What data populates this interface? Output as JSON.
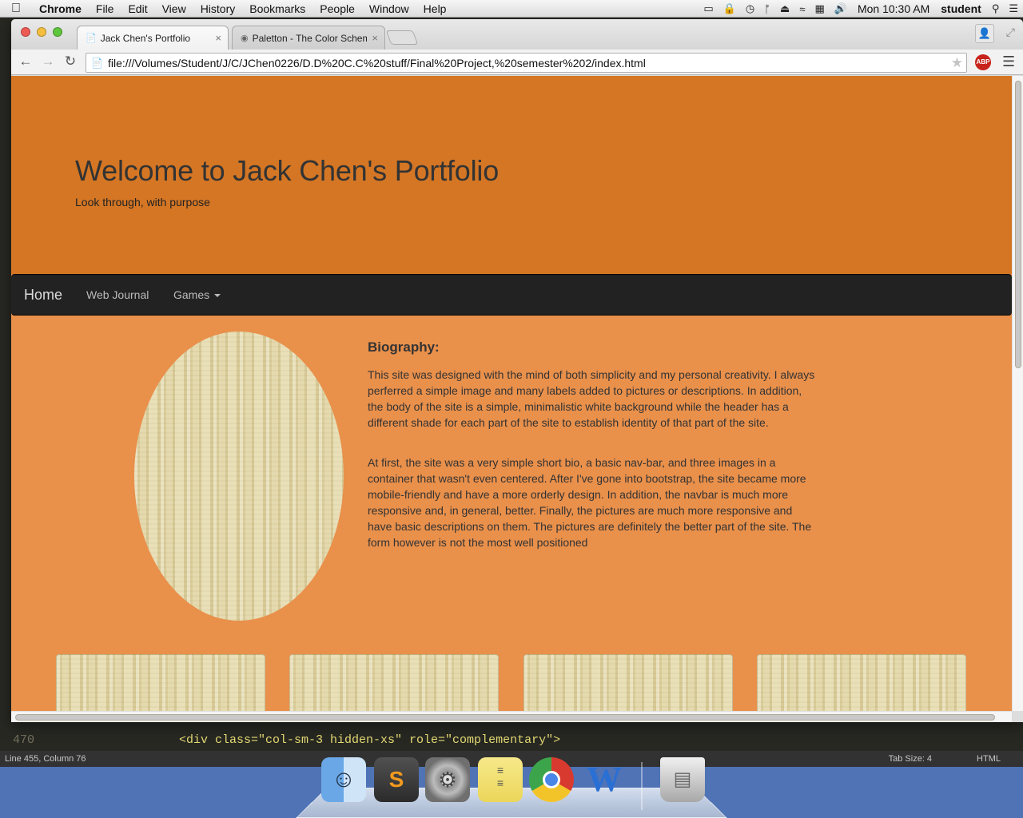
{
  "menubar": {
    "apple": "",
    "items": [
      "Chrome",
      "File",
      "Edit",
      "View",
      "History",
      "Bookmarks",
      "People",
      "Window",
      "Help"
    ],
    "clock": "Mon 10:30 AM",
    "user": "student"
  },
  "editor": {
    "line_number": "470",
    "code_line": "<div class=\"col-sm-3 hidden-xs\" role=\"complementary\">",
    "status_left": "Line 455, Column 76",
    "tab_size": "Tab Size: 4",
    "syntax": "HTML"
  },
  "browser": {
    "tabs": [
      {
        "title": "Jack Chen's Portfolio",
        "active": true
      },
      {
        "title": "Paletton - The Color Schem",
        "active": false
      }
    ],
    "url": "file:///Volumes/Student/J/C/JChen0226/D.D%20C.C%20stuff/Final%20Project,%20semester%202/index.html",
    "abp_label": "ABP"
  },
  "page": {
    "colors": {
      "jumbotron": "#d47624",
      "body": "#e9904b",
      "navbar": "#222222"
    },
    "jumbotron": {
      "title": "Welcome to Jack Chen's Portfolio",
      "subtitle": "Look through, with purpose"
    },
    "navbar": {
      "brand": "Home",
      "links": [
        "Web Journal",
        "Games"
      ]
    },
    "bio": {
      "heading": "Biography:",
      "paragraph1": "This site was designed with the mind of both simplicity and my personal creativity. I always perferred a simple image and many labels added to pictures or descriptions. In addition, the body of the site is a simple, minimalistic white background while the header has a different shade for each part of the site to establish identity of that part of the site.",
      "paragraph2": "At first, the site was a very simple short bio, a basic nav-bar, and three images in a container that wasn't even centered. After I've gone into bootstrap, the site became more mobile-friendly and have a more orderly design. In addition, the navbar is much more responsive and, in general, better. Finally, the pictures are much more responsive and have basic descriptions on them. The pictures are definitely the better part of the site. The form however is not the most well positioned"
    }
  },
  "dock": {
    "apps": [
      "finder-icon",
      "sublime-text-icon",
      "system-preferences-icon",
      "stickies-icon",
      "chrome-icon",
      "word-icon",
      "trash-icon"
    ],
    "sublime_glyph": "S",
    "word_glyph": "W"
  }
}
